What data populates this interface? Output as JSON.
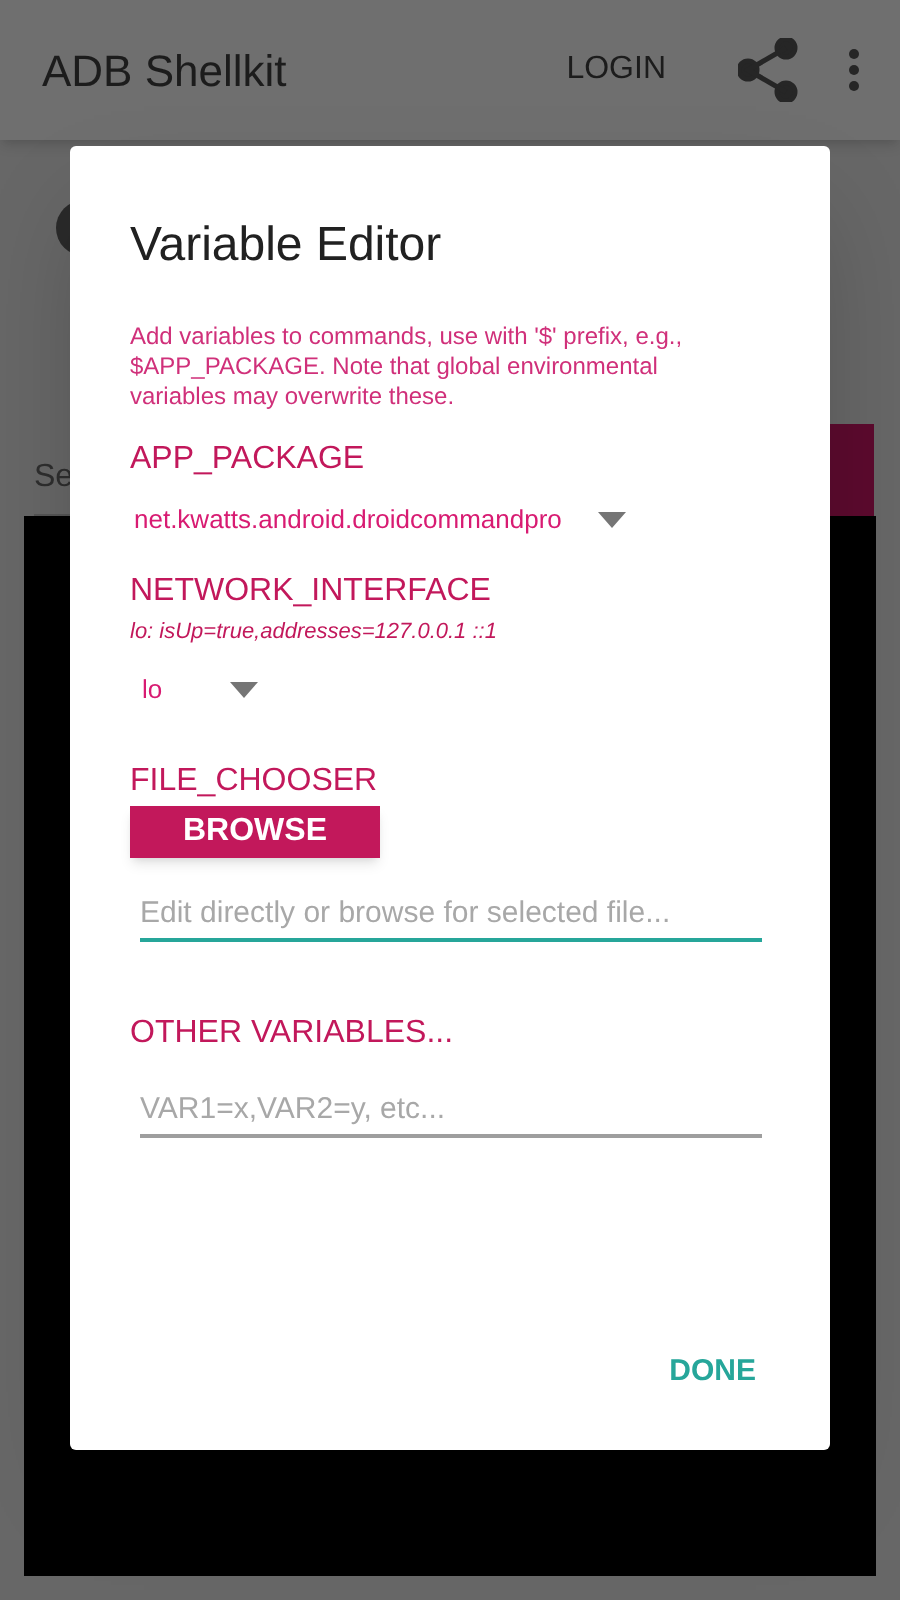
{
  "app_bar": {
    "title": "ADB Shellkit",
    "login": "LOGIN"
  },
  "background": {
    "search_placeholder": "Se"
  },
  "dialog": {
    "title": "Variable Editor",
    "description": "Add variables to commands, use with '$' prefix, e.g., $APP_PACKAGE. Note that global environmental variables may overwrite these.",
    "variables": [
      {
        "kind": "dropdown",
        "name": "APP_PACKAGE",
        "value": "net.kwatts.android.droidcommandpro"
      },
      {
        "kind": "dropdown",
        "name": "NETWORK_INTERFACE",
        "info": "lo: isUp=true,addresses=127.0.0.1 ::1",
        "value": "lo"
      },
      {
        "kind": "file",
        "name": "FILE_CHOOSER",
        "button": "BROWSE",
        "placeholder": "Edit directly or browse for selected file...",
        "focused": true
      },
      {
        "kind": "text",
        "name": "OTHER VARIABLES...",
        "placeholder": "VAR1=x,VAR2=y, etc...",
        "focused": false
      }
    ],
    "done": "DONE"
  }
}
